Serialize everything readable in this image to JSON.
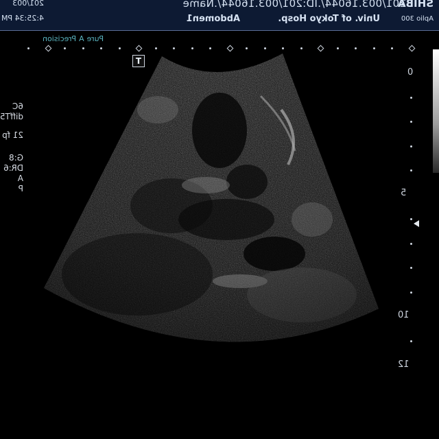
{
  "header": {
    "vendor": "SHIBA",
    "model": "Aplio 300",
    "id_line": "201/003.16044/.ID:201/003.16044/.Name",
    "hospital": "Univ. of Tokyo Hosp.",
    "preset": "Abdomen1",
    "date": "201/003",
    "time": "4:25:34 PM"
  },
  "mode_labels": {
    "pure": "Pure",
    "a": "A",
    "precision": "Precision"
  },
  "left_params": [
    "6C",
    "diffT5",
    "21 fp",
    "G:8",
    "DR:6",
    "A",
    "P"
  ],
  "depth_scale": {
    "labels": [
      "0",
      "5",
      "10",
      "12"
    ],
    "unit": "cm"
  },
  "marker": "T",
  "colors": {
    "header_bg": "#0d1a33",
    "header_text": "#d6e2f2",
    "mode_label": "#5ab4bf",
    "overlay_text": "#cfd6e0"
  },
  "icons": {
    "t-marker": "orientation-marker-icon",
    "focus": "focus-arrow-icon",
    "grayscale": "grayscale-bar-icon"
  }
}
